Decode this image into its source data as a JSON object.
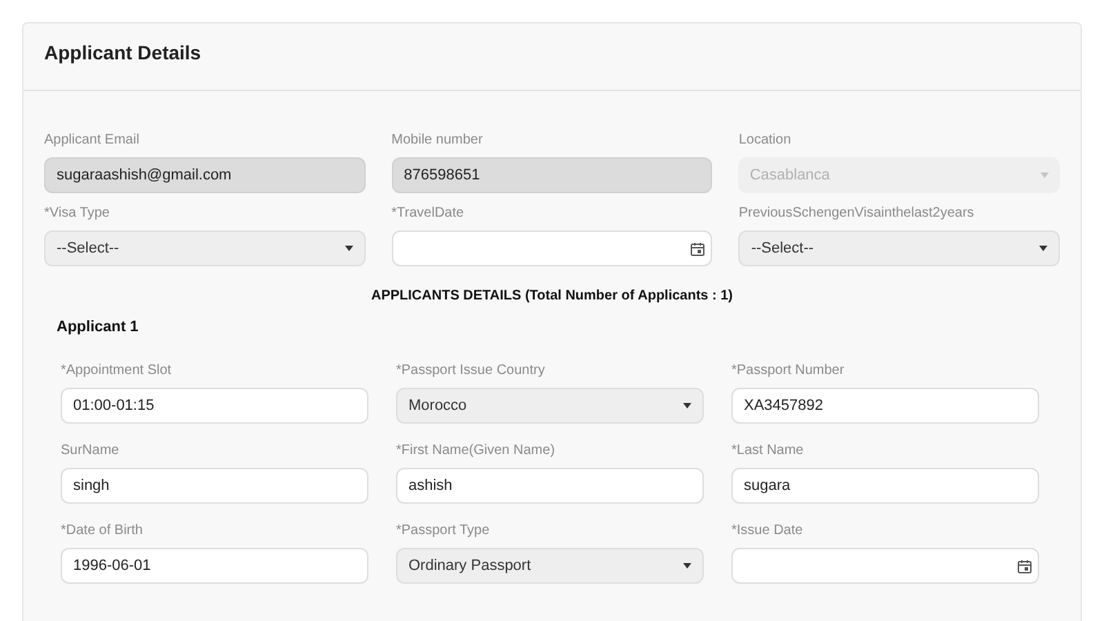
{
  "section_title": "Applicant Details",
  "fields": [
    {
      "label": "Applicant Email",
      "kind": "readonly",
      "value": "sugaraashish@gmail.com"
    },
    {
      "label": "Mobile number",
      "kind": "readonly",
      "value": "876598651"
    },
    {
      "label": "Location",
      "kind": "disabled",
      "value": "Casablanca"
    },
    {
      "label": "*Visa Type",
      "kind": "select",
      "value": "--Select--"
    },
    {
      "label": "*TravelDate",
      "kind": "date"
    },
    {
      "label": "PreviousSchengenVisainthelast2years",
      "kind": "select",
      "value": "--Select--"
    }
  ],
  "applicants_heading": "APPLICANTS DETAILS (Total Number of Applicants : 1)",
  "applicant": {
    "title": "Applicant 1",
    "fields": [
      {
        "label": "*Appointment Slot",
        "kind": "text",
        "value": "01:00-01:15"
      },
      {
        "label": "*Passport Issue Country",
        "kind": "select",
        "value": "Morocco"
      },
      {
        "label": "*Passport Number",
        "kind": "text",
        "value": "XA3457892"
      },
      {
        "label": "SurName",
        "kind": "text",
        "value": "singh"
      },
      {
        "label": "*First Name(Given Name)",
        "kind": "text",
        "value": "ashish"
      },
      {
        "label": "*Last Name",
        "kind": "text",
        "value": "sugara"
      },
      {
        "label": "*Date of Birth",
        "kind": "text",
        "value": "1996-06-01"
      },
      {
        "label": "*Passport Type",
        "kind": "select",
        "value": "Ordinary Passport"
      },
      {
        "label": "*Issue Date",
        "kind": "date"
      }
    ]
  }
}
